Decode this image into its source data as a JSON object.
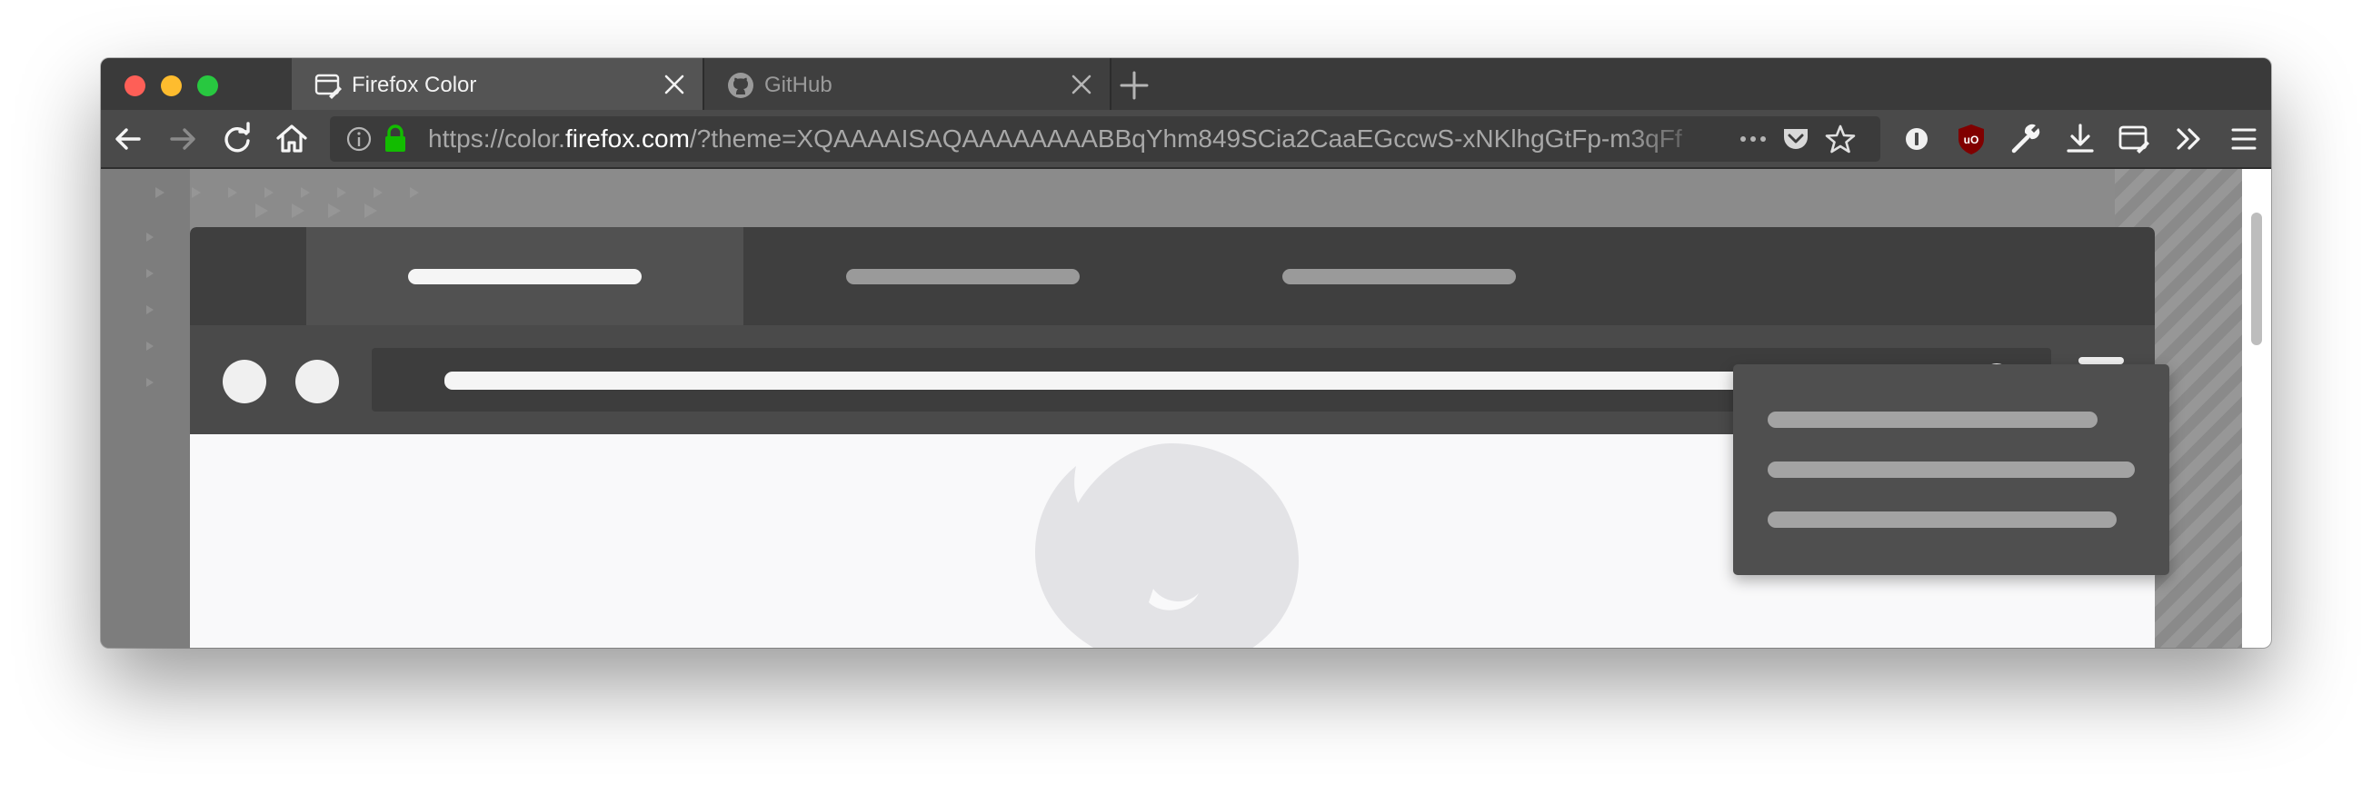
{
  "browser": {
    "tabs": [
      {
        "title": "Firefox Color",
        "active": true,
        "icon": "firefox-color-icon"
      },
      {
        "title": "GitHub",
        "active": false,
        "icon": "github-icon"
      }
    ],
    "url": {
      "prefix": "https://color.",
      "host": "firefox.com",
      "rest": "/?theme=XQAAAAISAQAAAAAAAABBqYhm849SCia2CaaEGccwS-xNKlhgGtFp-m3qFf"
    }
  },
  "colors": {
    "tabstrip": "#3a3a3a",
    "active_tab": "#545454",
    "navbar": "#4a4a4a",
    "urlbar": "#3b3b3b",
    "lock_green": "#12bc00",
    "ublock_red": "#800000"
  },
  "icons": [
    "back-icon",
    "forward-icon",
    "reload-icon",
    "home-icon",
    "info-icon",
    "lock-icon",
    "page-actions-icon",
    "pocket-icon",
    "bookmark-star-icon",
    "password-manager-icon",
    "ublock-origin-icon",
    "wrench-icon",
    "download-icon",
    "firefox-color-icon",
    "overflow-icon",
    "hamburger-menu-icon"
  ],
  "preview": {
    "description_hidden": ""
  }
}
